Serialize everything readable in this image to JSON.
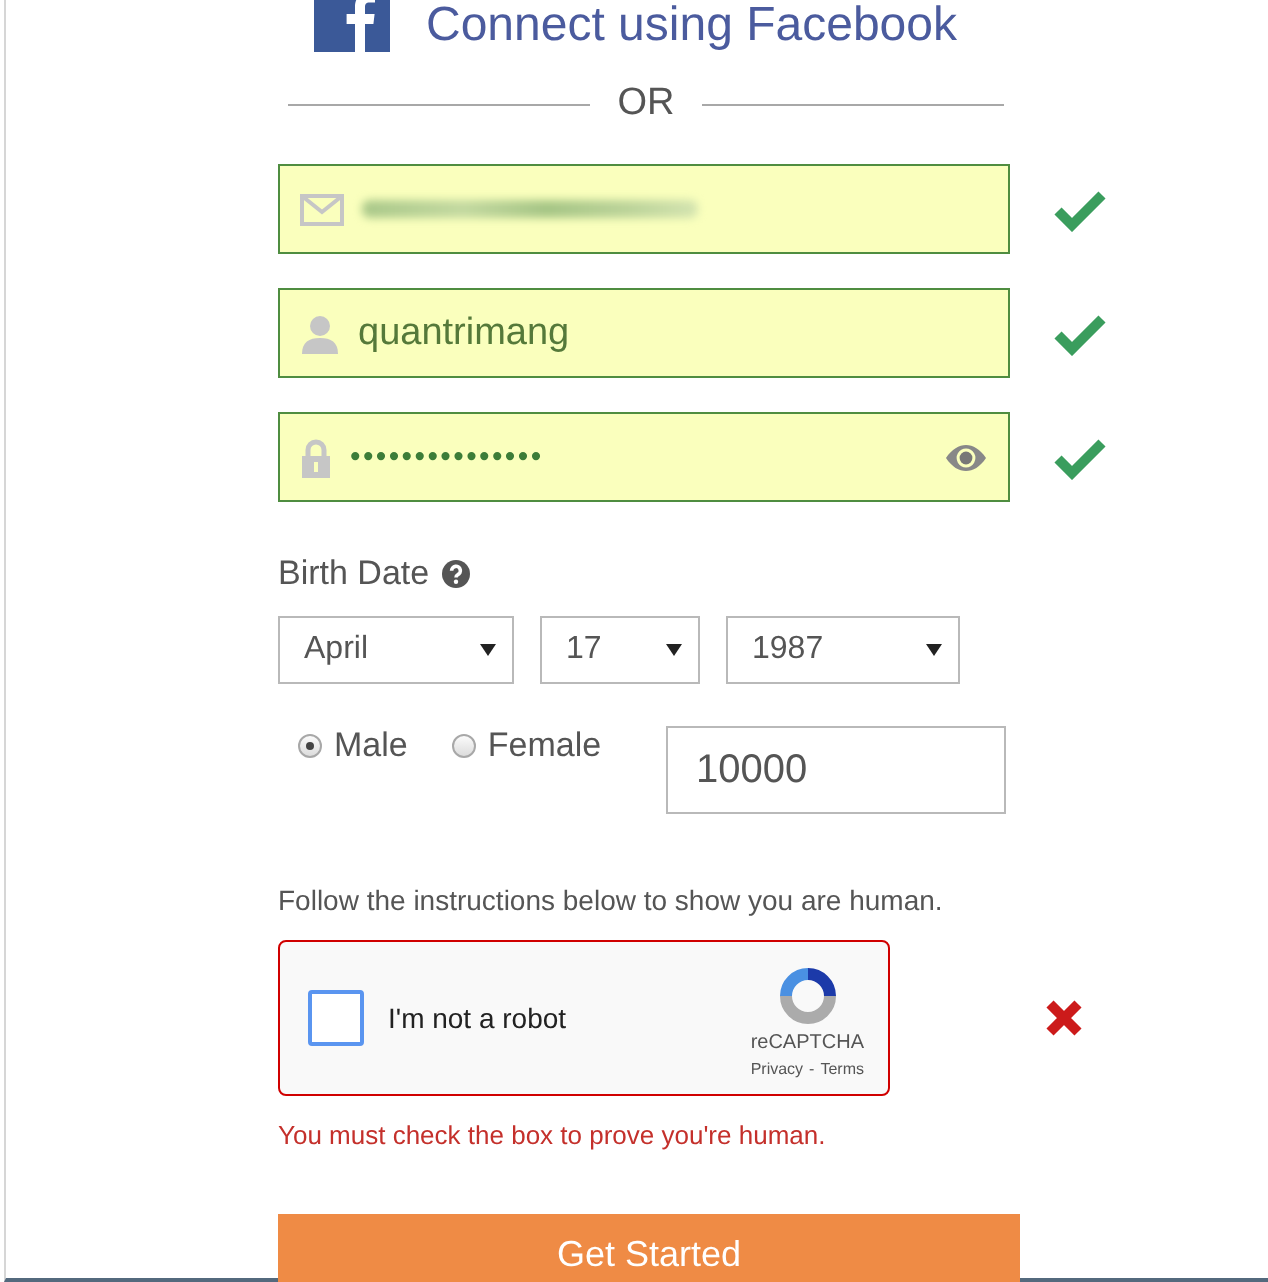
{
  "facebook_link": {
    "label": "Connect using Facebook"
  },
  "divider": {
    "label": "OR"
  },
  "fields": [
    {
      "kind": "email",
      "blurred": true,
      "autofilled": true,
      "valid": true
    },
    {
      "kind": "username",
      "value": "quantrimang",
      "autofilled": true,
      "valid": true
    },
    {
      "kind": "password",
      "value": "•••••••••••••••",
      "autofilled": true,
      "valid": true
    }
  ],
  "birth_date": {
    "label": "Birth Date",
    "selects": [
      {
        "value": "April"
      },
      {
        "value": "17"
      },
      {
        "value": "1987"
      }
    ]
  },
  "gender": [
    {
      "label": "Male",
      "selected": true
    },
    {
      "label": "Female",
      "selected": false
    }
  ],
  "text_field": {
    "value": "10000"
  },
  "captcha": {
    "instruction": "Follow the instructions below to show you are human.",
    "checkbox_label": "I'm not a robot",
    "checked": false,
    "brand": "reCAPTCHA",
    "privacy_link": "Privacy",
    "separator": "-",
    "terms_link": "Terms",
    "valid": false,
    "error": "You must check the box to prove you're human."
  },
  "submit_button": {
    "label": "Get Started"
  }
}
